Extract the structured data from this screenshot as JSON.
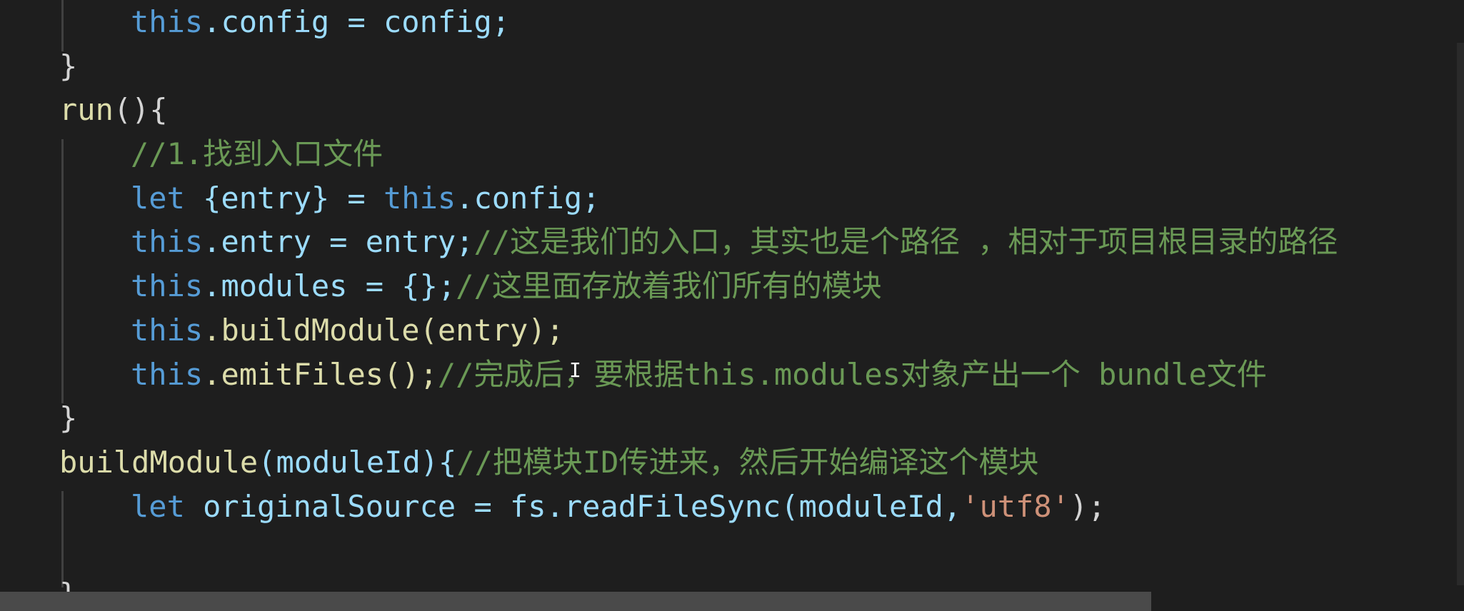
{
  "editor": {
    "theme": "dark",
    "colors": {
      "background": "#1e1e1e",
      "keyword": "#569cd6",
      "function": "#dcdcaa",
      "variable": "#9cdcfe",
      "comment": "#6a9955",
      "string": "#ce9178",
      "plain": "#d4d4d4"
    }
  },
  "code": {
    "line1": {
      "kw": "this",
      "rest": ".config = config;"
    },
    "line2": {
      "text": "}"
    },
    "line3": {
      "fn": "run",
      "rest": "(){"
    },
    "line4": {
      "comment": "//1.找到入口文件"
    },
    "line5": {
      "kw": "let",
      "rest": " {entry} = ",
      "kw2": "this",
      "rest2": ".config;"
    },
    "line6": {
      "kw": "this",
      "rest": ".entry = entry;",
      "comment": "//这是我们的入口，其实也是个路径 ，相对于项目根目录的路径"
    },
    "line7": {
      "kw": "this",
      "rest": ".modules = {};",
      "comment": "//这里面存放着我们所有的模块"
    },
    "line8": {
      "kw": "this",
      "rest": ".buildModule(entry);"
    },
    "line9": {
      "kw": "this",
      "rest": ".emitFiles();",
      "comment": "//完成后，要根据this.modules对象产出一个 bundle文件"
    },
    "line10": {
      "text": "}"
    },
    "line11": {
      "fn": "buildModule",
      "rest": "(moduleId){",
      "comment": "//把模块ID传进来，然后开始编译这个模块"
    },
    "line12": {
      "kw": "let",
      "rest": " originalSource = fs.readFileSync(moduleId,",
      "str": "'utf8'",
      "rest2": ");"
    },
    "line13": {
      "text": ""
    },
    "line14": {
      "text": "}"
    }
  },
  "cursor_glyph": "I"
}
